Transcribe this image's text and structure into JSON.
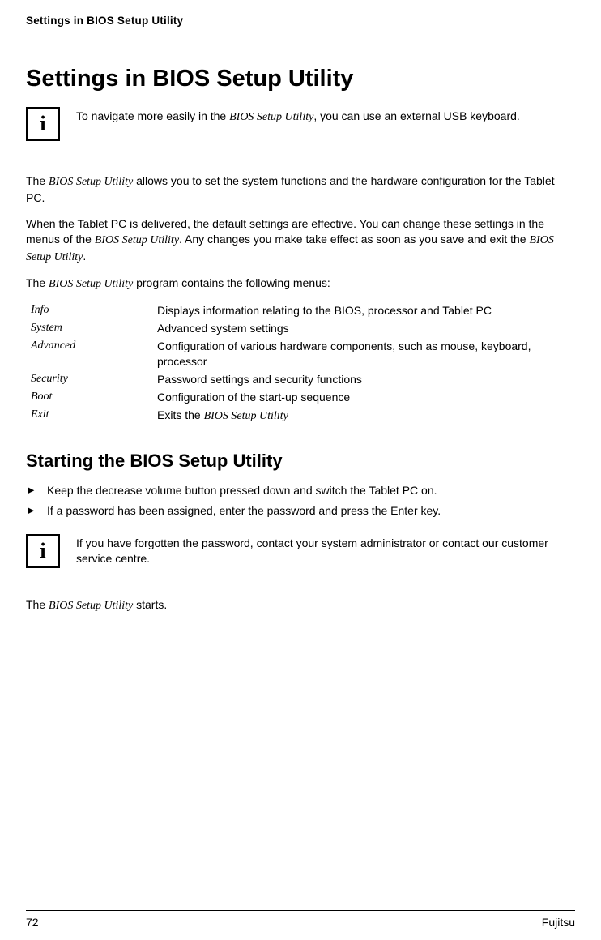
{
  "runningHeader": "Settings in BIOS Setup Utility",
  "title": "Settings in BIOS Setup Utility",
  "info1_a": "To navigate more easily in the ",
  "info1_b": "BIOS Setup Utility",
  "info1_c": ", you can use an external USB keyboard.",
  "para1_a": "The ",
  "para1_b": "BIOS Setup Utility",
  "para1_c": " allows you to set the system functions and the hardware configuration for the Tablet PC.",
  "para2_a": "When the Tablet PC is delivered, the default settings are effective. You can change these settings in the menus of the ",
  "para2_b": "BIOS Setup Utility",
  "para2_c": ". Any changes you make take effect as soon as you save and exit the ",
  "para2_d": "BIOS Setup Utility",
  "para2_e": ".",
  "para3_a": "The ",
  "para3_b": "BIOS Setup Utility",
  "para3_c": " program contains the following menus:",
  "menus": [
    {
      "term": "Info",
      "desc": "Displays information relating to the BIOS, processor and Tablet PC"
    },
    {
      "term": "System",
      "desc": "Advanced system settings"
    },
    {
      "term": "Advanced",
      "desc": "Configuration of various hardware components, such as mouse, keyboard, processor"
    },
    {
      "term": "Security",
      "desc": "Password settings and security functions"
    },
    {
      "term": "Boot",
      "desc": "Configuration of the start-up sequence"
    },
    {
      "term": "Exit",
      "desc_a": "Exits the ",
      "desc_b": "BIOS Setup Utility"
    }
  ],
  "h2": "Starting the BIOS Setup Utility",
  "step1": "Keep the decrease volume button pressed down and switch the Tablet PC on.",
  "step2": "If a password has been assigned, enter the password and press the Enter key.",
  "info2": "If you have forgotten the password, contact your system administrator or contact our customer service centre.",
  "para4_a": "The ",
  "para4_b": "BIOS Setup Utility",
  "para4_c": " starts.",
  "pageNum": "72",
  "brand": "Fujitsu",
  "marker": "►"
}
